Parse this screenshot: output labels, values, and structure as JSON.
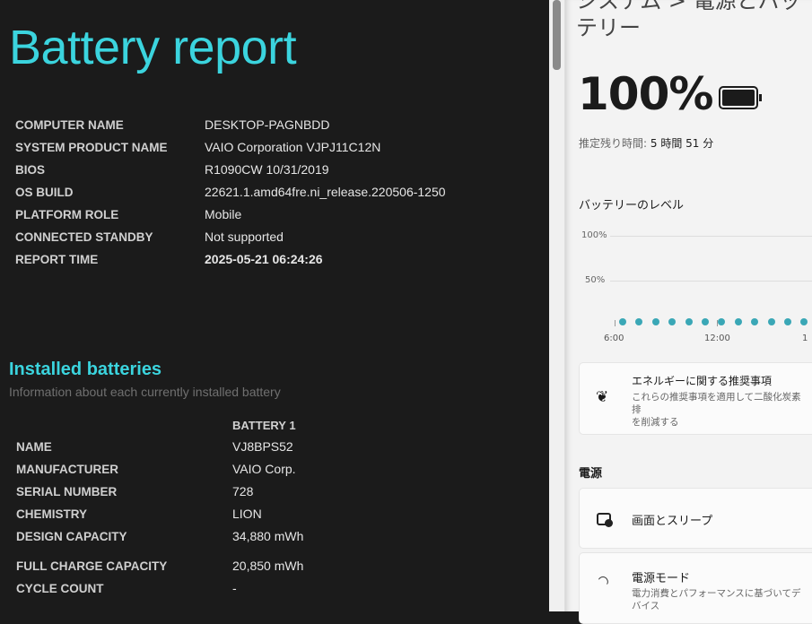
{
  "report": {
    "title": "Battery report",
    "system": [
      {
        "k": "COMPUTER NAME",
        "v": "DESKTOP-PAGNBDD"
      },
      {
        "k": "SYSTEM PRODUCT NAME",
        "v": "VAIO Corporation VJPJ11C12N"
      },
      {
        "k": "BIOS",
        "v": "R1090CW 10/31/2019"
      },
      {
        "k": "OS BUILD",
        "v": "22621.1.amd64fre.ni_release.220506-1250"
      },
      {
        "k": "PLATFORM ROLE",
        "v": "Mobile"
      },
      {
        "k": "CONNECTED STANDBY",
        "v": "Not supported"
      },
      {
        "k": "REPORT TIME",
        "v": "2025-05-21  06:24:26"
      }
    ],
    "installed_title": "Installed batteries",
    "installed_sub": "Information about each currently installed battery",
    "battery_header": "BATTERY 1",
    "battery": [
      {
        "k": "NAME",
        "v": "VJ8BPS52"
      },
      {
        "k": "MANUFACTURER",
        "v": "VAIO Corp."
      },
      {
        "k": "SERIAL NUMBER",
        "v": "728"
      },
      {
        "k": "CHEMISTRY",
        "v": "LION"
      },
      {
        "k": "DESIGN CAPACITY",
        "v": "34,880 mWh"
      },
      {
        "k": "FULL CHARGE CAPACITY",
        "v": "20,850 mWh"
      },
      {
        "k": "CYCLE COUNT",
        "v": "-"
      }
    ]
  },
  "settings": {
    "breadcrumb": "システム  >  電源とバッテリー",
    "percent": "100%",
    "remaining_label": "推定残り時間:",
    "remaining_value": "5 時間 51 分",
    "level_title": "バッテリーのレベル",
    "y_ticks": [
      "100%",
      "50%"
    ],
    "x_ticks": [
      "6:00",
      "12:00",
      "1"
    ],
    "dot_count": 12,
    "energy_title": "エネルギーに関する推奨事項",
    "energy_desc1": "これらの推奨事項を適用して二酸化炭素排",
    "energy_desc2": "を削減する",
    "power_section": "電源",
    "screen_sleep": "画面とスリープ",
    "power_mode": "電源モード",
    "power_mode_desc": "電力消費とパフォーマンスに基づいてデバイス",
    "accent": "#3aa7b6"
  }
}
